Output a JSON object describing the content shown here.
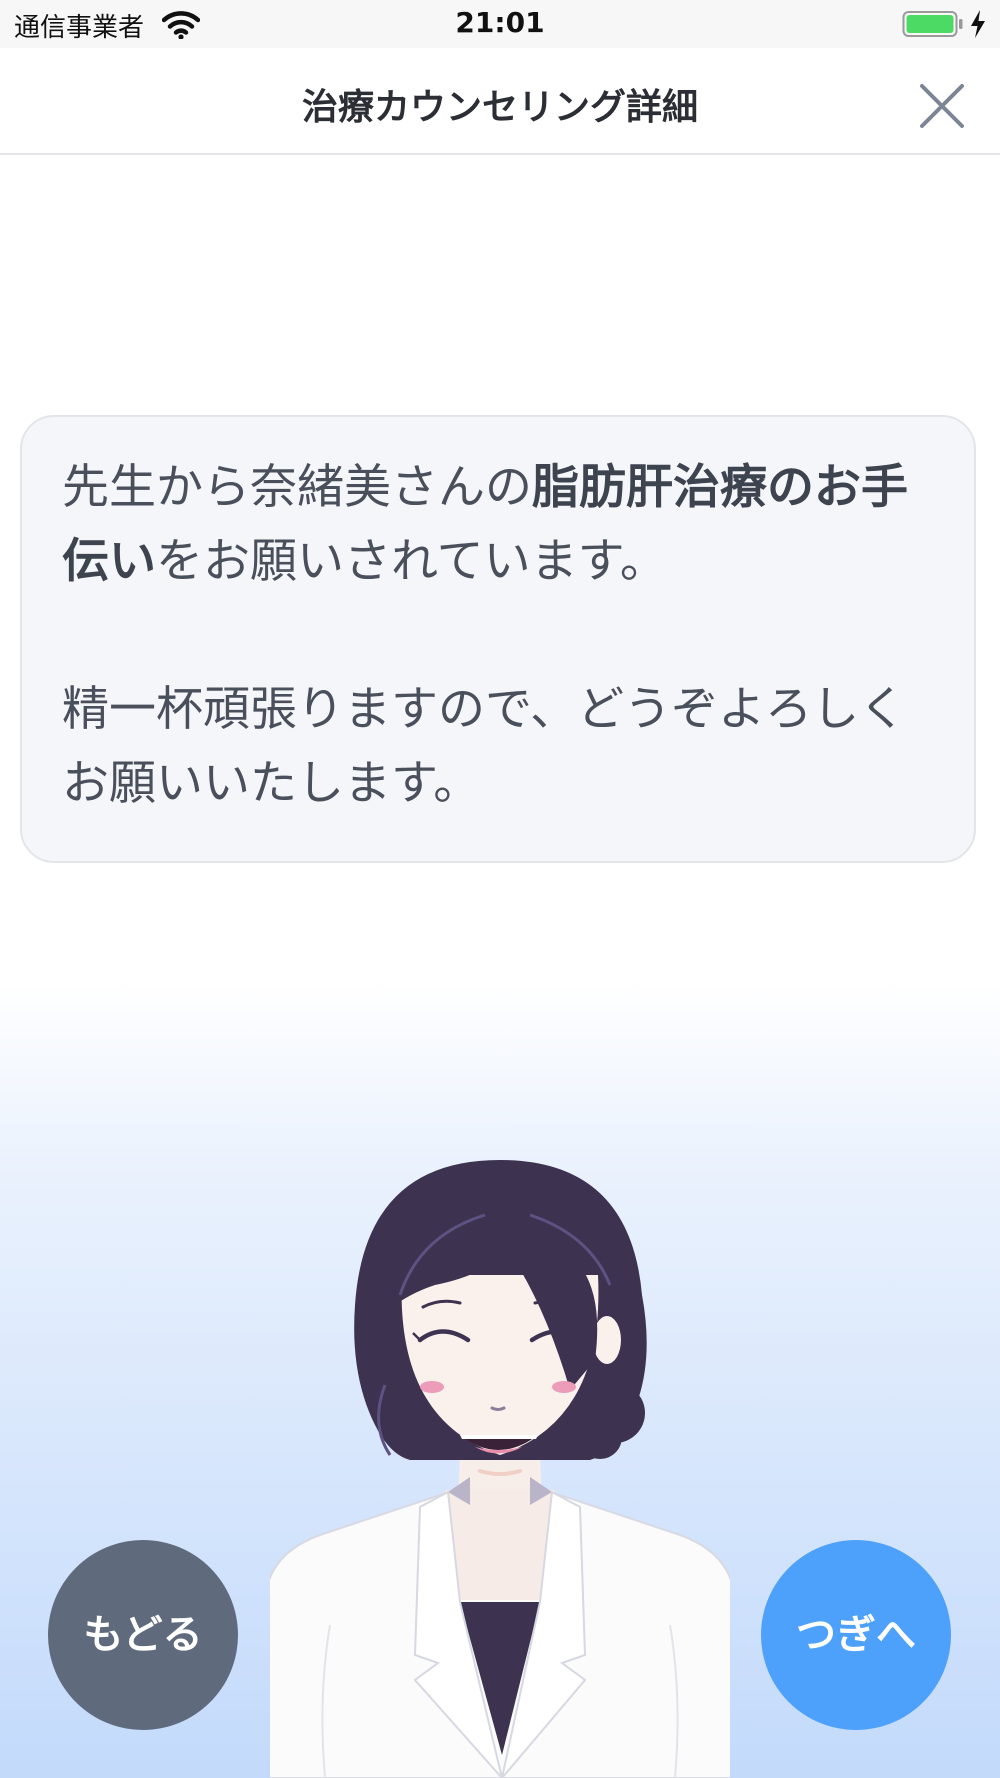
{
  "status_bar": {
    "carrier": "通信事業者",
    "time": "21:01",
    "wifi_icon": "wifi-icon",
    "battery_icon": "battery-icon",
    "charging_icon": "charging-bolt-icon",
    "battery_level": 1.0
  },
  "nav": {
    "title": "治療カウンセリング詳細",
    "close_icon": "close-icon"
  },
  "message": {
    "p1_a": "先生から奈緒美さんの",
    "p1_bold": "脂肪肝治療のお手伝い",
    "p1_b": "をお願いされています。",
    "p2": "精一杯頑張りますので、どうぞよろしくお願いいたします。"
  },
  "buttons": {
    "back": "もどる",
    "next": "つぎへ"
  },
  "colors": {
    "back_button": "#5f6a7d",
    "next_button": "#4ea1fb",
    "battery": "#4cd964",
    "hair": "#3d3350",
    "gradient_bottom": "#c3dafb"
  }
}
